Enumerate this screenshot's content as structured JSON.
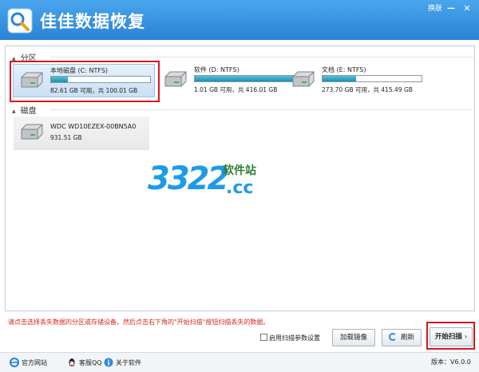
{
  "window": {
    "title": "佳佳数据恢复",
    "skin_label": "换肤",
    "minimize_label": "—",
    "close_label": "✕"
  },
  "sections": {
    "partitions_label": "分区",
    "disks_label": "磁盘"
  },
  "partitions": [
    {
      "name": "本地磁盘 (C: NTFS)",
      "info": "82.61 GB 可用，共 100.01 GB",
      "used_fraction": 0.17,
      "selected": true
    },
    {
      "name": "软件 (D: NTFS)",
      "info": "1.01 GB 可用，共 416.01 GB",
      "used_fraction": 1.0,
      "selected": false
    },
    {
      "name": "文档 (E: NTFS)",
      "info": "273.70 GB 可用，共 415.49 GB",
      "used_fraction": 0.34,
      "selected": false
    }
  ],
  "disks": [
    {
      "name": "WDC WD10EZEX-00BN5A0",
      "info": "931.51 GB"
    }
  ],
  "watermark": {
    "number": "3322",
    "subtitle": "软件站",
    "domain": ".cc"
  },
  "bottom": {
    "hint": "请点击选择丢失数据的分区或存储设备，然后点击右下角的\"开始扫描\"按钮扫描丢失的数据。",
    "checkbox_label": "启用扫描参数设置",
    "load_image_label": "加载镜像",
    "refresh_label": "刷新",
    "start_scan_label": "开始扫描"
  },
  "footer": {
    "website_label": "官方网站",
    "qq_label": "客服QQ",
    "about_label": "关于软件",
    "version_label": "版本：V6.0.0"
  },
  "colors": {
    "titlebar": "#2a82d6",
    "progress_fill": "#1d8fb0",
    "highlight": "#e0141a",
    "hint_text": "#d8261a"
  }
}
